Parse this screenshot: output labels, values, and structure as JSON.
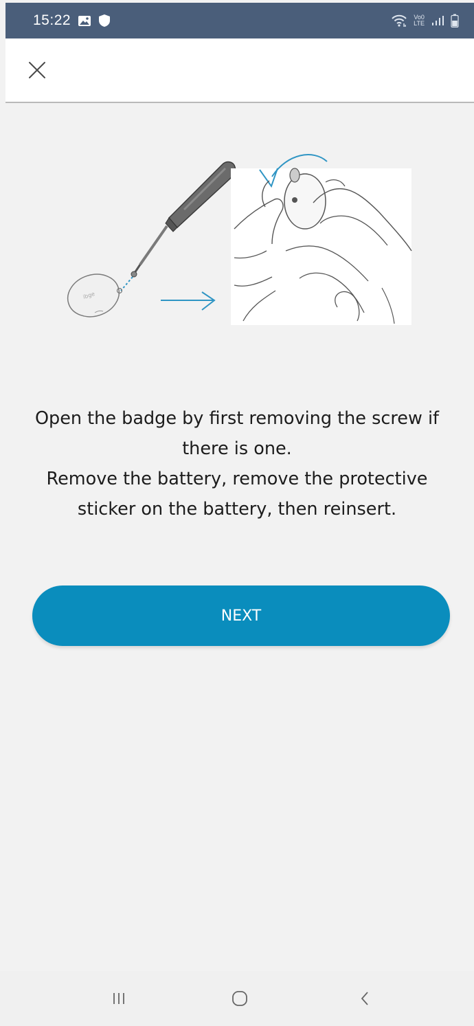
{
  "status_bar": {
    "time": "15:22",
    "left_icons": [
      "gallery-icon",
      "shield-icon"
    ],
    "right_icons": [
      "wifi-icon",
      "volte-lte-icon",
      "signal-icon",
      "battery-icon"
    ],
    "lte_top": "Vo0",
    "lte_bottom": "LTE",
    "background_color": "#4a5e7a"
  },
  "app_bar": {
    "close_icon": "close-icon"
  },
  "illustration": {
    "icon": "badge-battery-illustration",
    "accent_color": "#2f95c4"
  },
  "instructions": {
    "line1": "Open the badge by first removing the screw if there is one.",
    "line2": "Remove the battery, remove the protective sticker on the battery, then reinsert."
  },
  "next_button": {
    "label": "NEXT",
    "color": "#0a8dbd"
  },
  "nav_bar": {
    "icons": [
      "recent-apps-icon",
      "home-icon",
      "back-icon"
    ]
  }
}
